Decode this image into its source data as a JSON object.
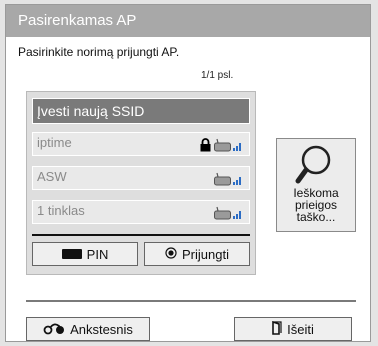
{
  "dialog": {
    "title": "Pasirenkamas AP",
    "subtitle": "Pasirinkite norimą prijungti AP.",
    "page_indicator": "1/1 psl."
  },
  "ap_list": {
    "new_ssid_label": "Įvesti naują SSID",
    "items": [
      {
        "name": "iptime",
        "secured": true
      },
      {
        "name": "ASW",
        "secured": false
      },
      {
        "name": "1 tinklas",
        "secured": false
      }
    ]
  },
  "buttons": {
    "pin_label": "PIN",
    "connect_label": "Prijungti",
    "search_label": "Ieškoma prieigos taško...",
    "back_label": "Ankstesnis",
    "exit_label": "Išeiti"
  },
  "icons": {
    "pin_key": "black-remote-key-icon",
    "connect_key": "ok-radio-icon",
    "search": "magnifier-icon",
    "back": "back-arrow-icon",
    "exit": "exit-door-icon",
    "lock": "lock-icon",
    "router": "wifi-router-icon"
  },
  "colors": {
    "title_bar": "#a8a8a8",
    "selected_item": "#7a7a7a",
    "wifi_signal": "#2b6cc4"
  }
}
